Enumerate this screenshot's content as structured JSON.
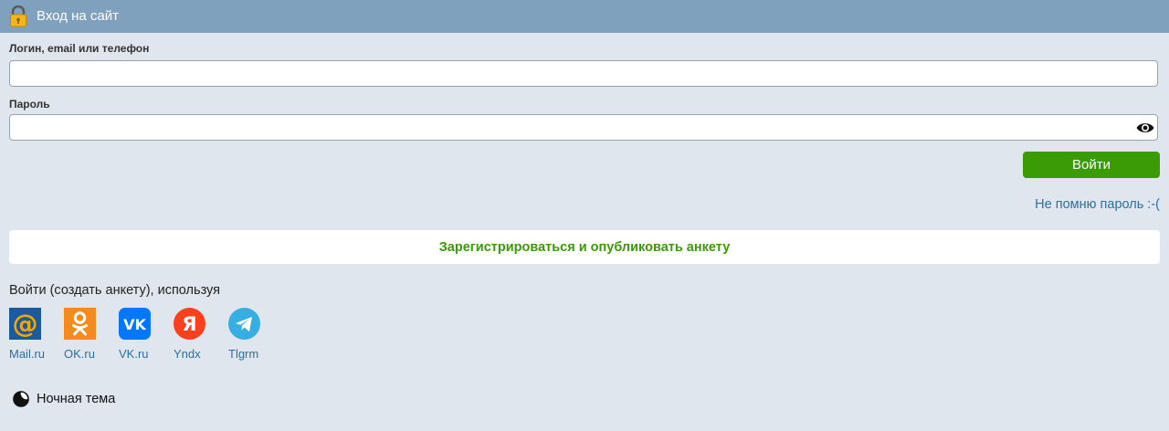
{
  "header": {
    "title": "Вход на сайт",
    "icon": "lock-icon"
  },
  "login": {
    "label": "Логин, email или телефон",
    "value": "",
    "placeholder": ""
  },
  "password": {
    "label": "Пароль",
    "value": "",
    "placeholder": "",
    "icon": "eye-icon"
  },
  "actions": {
    "login_label": "Войти",
    "forgot_label": "Не помню пароль :-(",
    "register_label": "Зарегистрироваться и опубликовать анкету"
  },
  "social": {
    "title": "Войти (создать анкету), используя",
    "items": [
      {
        "label": "Mail.ru",
        "icon": "mailru-icon",
        "color": "#1b5a9c"
      },
      {
        "label": "OK.ru",
        "icon": "odnoklassniki-icon",
        "color": "#f38b1e"
      },
      {
        "label": "VK.ru",
        "icon": "vk-icon",
        "color": "#0077ff"
      },
      {
        "label": "Yndx",
        "icon": "yandex-icon",
        "color": "#fc3f1d"
      },
      {
        "label": "Tlgrm",
        "icon": "telegram-icon",
        "color": "#37aee2"
      }
    ]
  },
  "theme": {
    "label": "Ночная тема",
    "icon": "moon-icon"
  },
  "colors": {
    "header": "#7fa1bd",
    "background": "#dfe6ee",
    "accent": "#3a9b05",
    "link": "#2f6f9f"
  }
}
